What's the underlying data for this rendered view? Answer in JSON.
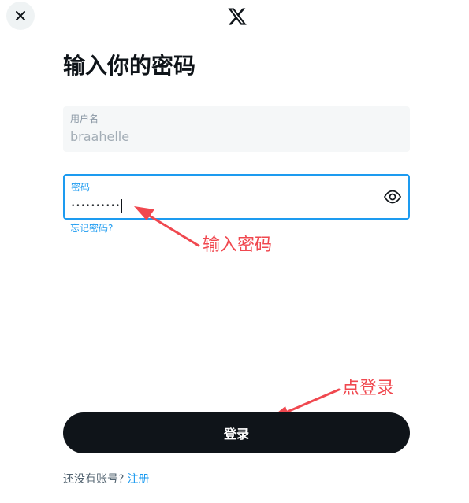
{
  "header": {
    "close_icon": "close-icon",
    "logo_icon": "x-logo-icon"
  },
  "title": "输入你的密码",
  "username_field": {
    "label": "用户名",
    "value": "braahelle"
  },
  "password_field": {
    "label": "密码",
    "masked_value": "••••••••••",
    "toggle_icon": "eye-icon"
  },
  "forgot_password": "忘记密码?",
  "annotations": {
    "password_hint": "输入密码",
    "login_hint": "点登录",
    "color": "#f0484f"
  },
  "login_button": {
    "label": "登录"
  },
  "signup": {
    "prompt": "还没有账号?",
    "link": "注册"
  },
  "colors": {
    "accent": "#1d9bf0",
    "button": "#0f1419",
    "annotation": "#f0484f"
  }
}
